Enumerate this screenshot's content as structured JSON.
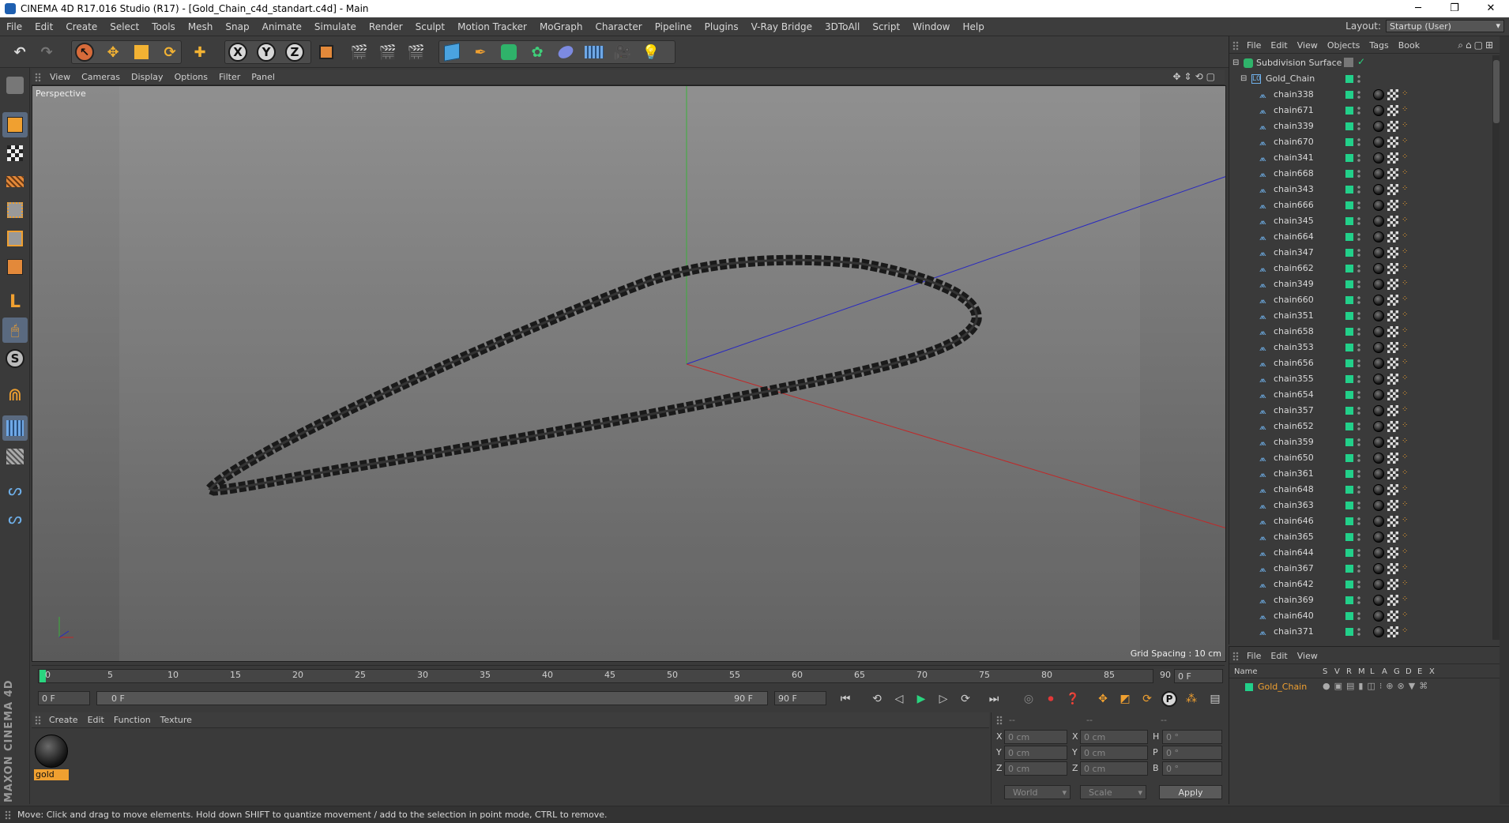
{
  "window": {
    "title": "CINEMA 4D R17.016 Studio (R17) - [Gold_Chain_c4d_standart.c4d] - Main",
    "min": "─",
    "restore": "❐",
    "close": "✕"
  },
  "menu": [
    "File",
    "Edit",
    "Create",
    "Select",
    "Tools",
    "Mesh",
    "Snap",
    "Animate",
    "Simulate",
    "Render",
    "Sculpt",
    "Motion Tracker",
    "MoGraph",
    "Character",
    "Pipeline",
    "Plugins",
    "V-Ray Bridge",
    "3DToAll",
    "Script",
    "Window",
    "Help"
  ],
  "layout": {
    "label": "Layout:",
    "value": "Startup (User)"
  },
  "toolbar": {
    "x": "X",
    "y": "Y",
    "z": "Z"
  },
  "viewport": {
    "menu": [
      "View",
      "Cameras",
      "Display",
      "Options",
      "Filter",
      "Panel"
    ],
    "label": "Perspective",
    "grid_spacing": "Grid Spacing : 10 cm"
  },
  "timeline": {
    "ticks": [
      "0",
      "5",
      "10",
      "15",
      "20",
      "25",
      "30",
      "35",
      "40",
      "45",
      "50",
      "55",
      "60",
      "65",
      "70",
      "75",
      "80",
      "85",
      "90"
    ],
    "end_frame": "0 F"
  },
  "transport": {
    "start": "0 F",
    "range_start": "0 F",
    "range_end": "90 F",
    "end": "90 F"
  },
  "material": {
    "menu": [
      "Create",
      "Edit",
      "Function",
      "Texture"
    ],
    "name": "gold"
  },
  "coords": {
    "headers": [
      "--",
      "--",
      "--"
    ],
    "rows": [
      {
        "a": "X",
        "av": "0 cm",
        "b": "X",
        "bv": "0 cm",
        "c": "H",
        "cv": "0 °"
      },
      {
        "a": "Y",
        "av": "0 cm",
        "b": "Y",
        "bv": "0 cm",
        "c": "P",
        "cv": "0 °"
      },
      {
        "a": "Z",
        "av": "0 cm",
        "b": "Z",
        "bv": "0 cm",
        "c": "B",
        "cv": "0 °"
      }
    ],
    "mode1": "World",
    "mode2": "Scale",
    "apply": "Apply"
  },
  "objects": {
    "menu": [
      "File",
      "Edit",
      "View",
      "Objects",
      "Tags",
      "Book"
    ],
    "root": "Subdivision Surface",
    "group": "Gold_Chain",
    "items": [
      "chain338",
      "chain671",
      "chain339",
      "chain670",
      "chain341",
      "chain668",
      "chain343",
      "chain666",
      "chain345",
      "chain664",
      "chain347",
      "chain662",
      "chain349",
      "chain660",
      "chain351",
      "chain658",
      "chain353",
      "chain656",
      "chain355",
      "chain654",
      "chain357",
      "chain652",
      "chain359",
      "chain650",
      "chain361",
      "chain648",
      "chain363",
      "chain646",
      "chain365",
      "chain644",
      "chain367",
      "chain642",
      "chain369",
      "chain640",
      "chain371"
    ]
  },
  "layers": {
    "menu": [
      "File",
      "Edit",
      "View"
    ],
    "cols": [
      "Name",
      "S",
      "V",
      "R",
      "M",
      "L",
      "A",
      "G",
      "D",
      "E",
      "X"
    ],
    "item": "Gold_Chain"
  },
  "maxon": "MAXON CINEMA 4D",
  "status": "Move: Click and drag to move elements. Hold down SHIFT to quantize movement / add to the selection in point mode, CTRL to remove."
}
